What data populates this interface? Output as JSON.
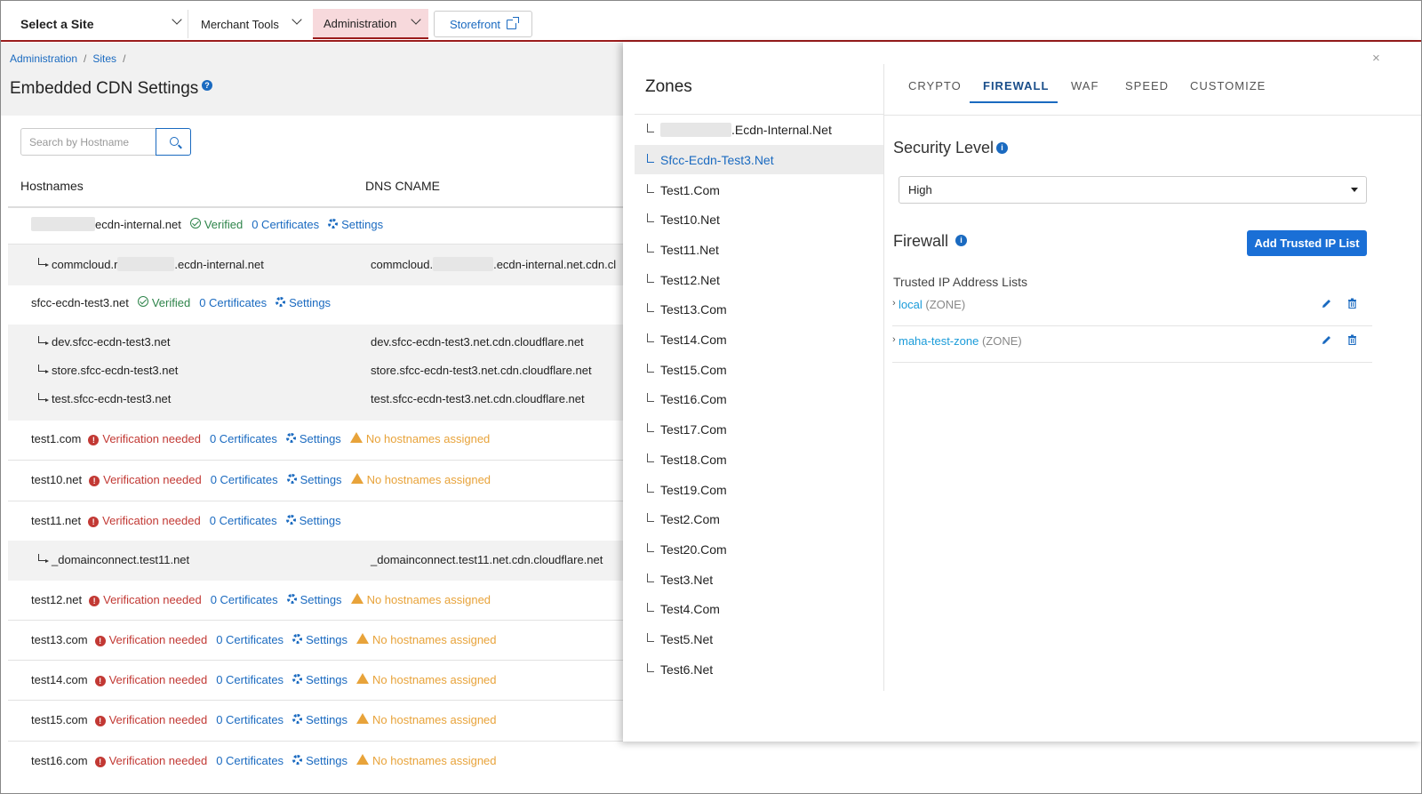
{
  "nav": {
    "site_select": "Select a Site",
    "merchant_tools": "Merchant Tools",
    "administration": "Administration",
    "storefront": "Storefront"
  },
  "breadcrumb": [
    "Administration",
    "Sites"
  ],
  "page": {
    "title": "Embedded CDN Settings",
    "search_placeholder": "Search by Hostname"
  },
  "columns": [
    "Hostnames",
    "DNS CNAME"
  ],
  "labels": {
    "verified": "Verified",
    "verification_needed": "Verification needed",
    "certificates": "0 Certificates",
    "settings": "Settings",
    "no_hostnames": "No hostnames assigned"
  },
  "hosts": [
    {
      "name": "ecdn-internal.net",
      "status": "Verified"
    },
    {
      "sub": "commcloud.r",
      "sub_tail": ".ecdn-internal.net",
      "cname": "commcloud.",
      "cname_tail": ".ecdn-internal.net.cdn.cl"
    },
    {
      "name": "sfcc-ecdn-test3.net",
      "status": "Verified"
    },
    {
      "sub": "dev.sfcc-ecdn-test3.net",
      "cname": "dev.sfcc-ecdn-test3.net.cdn.cloudflare.net"
    },
    {
      "sub": "store.sfcc-ecdn-test3.net",
      "cname": "store.sfcc-ecdn-test3.net.cdn.cloudflare.net"
    },
    {
      "sub": "test.sfcc-ecdn-test3.net",
      "cname": "test.sfcc-ecdn-test3.net.cdn.cloudflare.net"
    },
    {
      "name": "test1.com"
    },
    {
      "name": "test10.net"
    },
    {
      "name": "test11.net"
    },
    {
      "sub": "_domainconnect.test11.net",
      "cname": "_domainconnect.test11.net.cdn.cloudflare.net"
    },
    {
      "name": "test12.net"
    },
    {
      "name": "test13.com"
    },
    {
      "name": "test14.com"
    },
    {
      "name": "test15.com"
    },
    {
      "name": "test16.com"
    }
  ],
  "panel": {
    "close": "×",
    "zones_title": "Zones",
    "zones": [
      ".Ecdn-Internal.Net",
      "Sfcc-Ecdn-Test3.Net",
      "Test1.Com",
      "Test10.Net",
      "Test11.Net",
      "Test12.Net",
      "Test13.Com",
      "Test14.Com",
      "Test15.Com",
      "Test16.Com",
      "Test17.Com",
      "Test18.Com",
      "Test19.Com",
      "Test2.Com",
      "Test20.Com",
      "Test3.Net",
      "Test4.Com",
      "Test5.Net",
      "Test6.Net"
    ],
    "tabs": [
      "CRYPTO",
      "FIREWALL",
      "WAF",
      "SPEED",
      "CUSTOMIZE"
    ],
    "active_tab": "FIREWALL",
    "security_level_title": "Security Level",
    "security_level_value": "High",
    "firewall_title": "Firewall",
    "add_button": "Add Trusted IP List",
    "trusted_label": "Trusted IP Address Lists",
    "ip_lists": [
      {
        "name": "local",
        "scope": "(ZONE)"
      },
      {
        "name": "maha-test-zone",
        "scope": "(ZONE)"
      }
    ]
  },
  "colors": {
    "brand_red": "#9b1c1c",
    "link_blue": "#1a6ac0",
    "ok_green": "#2e844a",
    "error_red": "#c23934",
    "warn_orange": "#e8a33a",
    "button_blue": "#1a6fd6"
  }
}
